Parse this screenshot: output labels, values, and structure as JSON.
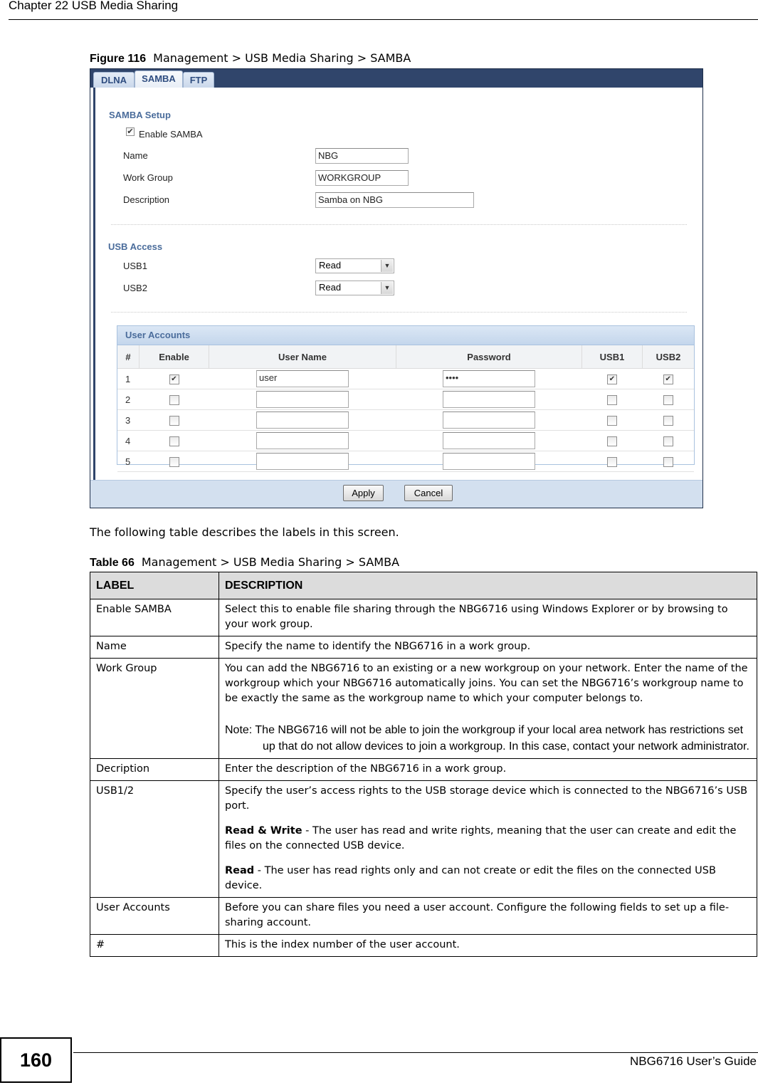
{
  "page": {
    "chapter_header": "Chapter 22 USB Media Sharing",
    "page_number": "160",
    "guide_title": "NBG6716 User’s Guide"
  },
  "figure": {
    "label": "Figure 116",
    "title": "Management >  USB Media Sharing > SAMBA"
  },
  "screen": {
    "tabs": [
      {
        "label": "DLNA",
        "active": false
      },
      {
        "label": "SAMBA",
        "active": true
      },
      {
        "label": "FTP",
        "active": false
      }
    ],
    "samba_setup": {
      "title": "SAMBA Setup",
      "enable_label": "Enable SAMBA",
      "enable_checked": true,
      "name_label": "Name",
      "name_value": "NBG",
      "workgroup_label": "Work Group",
      "workgroup_value": "WORKGROUP",
      "description_label": "Description",
      "description_value": "Samba on NBG"
    },
    "usb_access": {
      "title": "USB Access",
      "usb1_label": "USB1",
      "usb1_value": "Read",
      "usb2_label": "USB2",
      "usb2_value": "Read"
    },
    "user_accounts": {
      "title": "User Accounts",
      "columns": [
        "#",
        "Enable",
        "User Name",
        "Password",
        "USB1",
        "USB2"
      ],
      "rows": [
        {
          "index": "1",
          "enable": true,
          "username": "user",
          "password": "••••",
          "usb1": true,
          "usb2": true
        },
        {
          "index": "2",
          "enable": false,
          "username": "",
          "password": "",
          "usb1": false,
          "usb2": false
        },
        {
          "index": "3",
          "enable": false,
          "username": "",
          "password": "",
          "usb1": false,
          "usb2": false
        },
        {
          "index": "4",
          "enable": false,
          "username": "",
          "password": "",
          "usb1": false,
          "usb2": false
        },
        {
          "index": "5",
          "enable": false,
          "username": "",
          "password": "",
          "usb1": false,
          "usb2": false
        }
      ]
    },
    "buttons": {
      "apply": "Apply",
      "cancel": "Cancel"
    },
    "check_glyph": "✔"
  },
  "intro_text": "The following table describes the labels in this screen.",
  "table": {
    "label": "Table 66",
    "title": "Management >  USB Media Sharing > SAMBA",
    "headers": [
      "LABEL",
      "DESCRIPTION"
    ],
    "rows": [
      {
        "label": "Enable SAMBA",
        "paragraphs": [
          "Select this to enable file sharing through the NBG6716 using Windows Explorer or by browsing to your work group."
        ]
      },
      {
        "label": "Name",
        "paragraphs": [
          "Specify the name to identify the NBG6716 in a work group."
        ]
      },
      {
        "label": "Work Group",
        "paragraphs": [
          "You can add the NBG6716 to an existing or a new workgroup on your network. Enter the name of the workgroup which your NBG6716 automatically joins. You can set the NBG6716’s workgroup name to be exactly the same as the workgroup name to which your computer belongs to."
        ],
        "note": "Note: The NBG6716 will not be able to join the workgroup if your local area network has restrictions set up that do not allow devices to join a workgroup. In this case, contact your network administrator."
      },
      {
        "label": "Decription",
        "paragraphs": [
          "Enter the description of the NBG6716 in a work group."
        ]
      },
      {
        "label": "USB1/2",
        "paragraphs": [
          "Specify the user’s access rights to the USB storage device which is connected to the NBG6716’s USB port."
        ],
        "terms": [
          {
            "term": "Read & Write",
            "text": " - The user has read and write rights, meaning that the user can create and edit the files on the connected USB device."
          },
          {
            "term": "Read",
            "text": " - The user has read rights only and can not create or edit the files on the connected USB device."
          }
        ]
      },
      {
        "label": "User Accounts",
        "paragraphs": [
          "Before you can share files you need a user account. Configure the following fields to set up a file-sharing account."
        ]
      },
      {
        "label": "#",
        "paragraphs": [
          "This is the index number of the user account."
        ]
      }
    ]
  }
}
